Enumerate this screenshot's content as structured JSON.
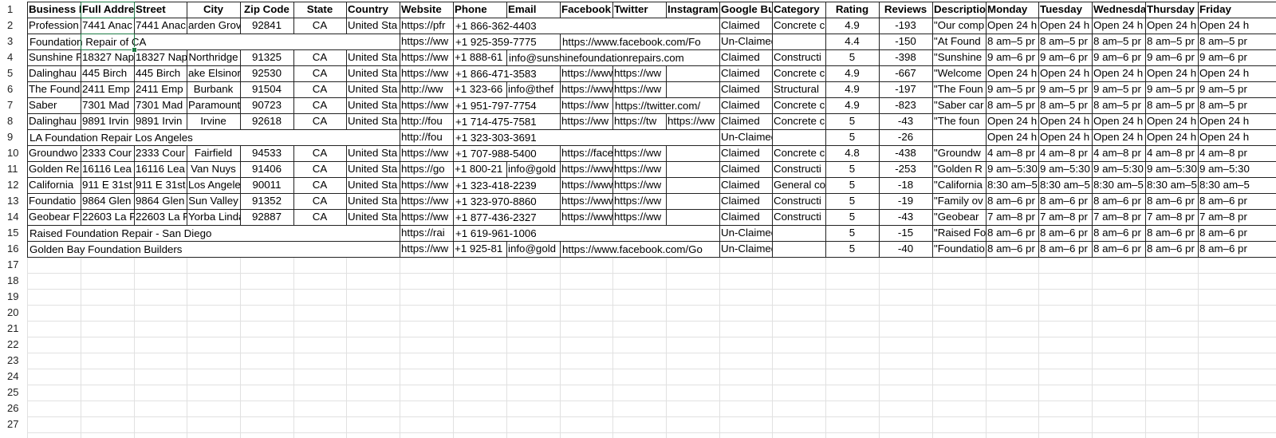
{
  "row_numbers": [
    "1",
    "2",
    "3",
    "4",
    "5",
    "6",
    "7",
    "8",
    "9",
    "10",
    "11",
    "12",
    "13",
    "14",
    "15",
    "16",
    "17",
    "18",
    "19",
    "20",
    "21",
    "22",
    "23",
    "24",
    "25",
    "26",
    "27"
  ],
  "headers": [
    "Business N",
    "Full Addre",
    "Street",
    "City",
    "Zip Code",
    "State",
    "Country",
    "Website",
    "Phone",
    "Email",
    "Facebook",
    "Twitter",
    "Instagram",
    "Google Bu",
    "Category",
    "Rating",
    "Reviews",
    "Descriptio",
    "Monday",
    "Tuesday",
    "Wednesda",
    "Thursday",
    "Friday"
  ],
  "rows": [
    [
      "Profession",
      "7441 Anac",
      "7441 Anac",
      "arden Grov",
      "92841",
      "CA",
      "United Sta",
      "https://pfr",
      "+1 866-362-4403",
      "",
      "",
      "",
      "",
      "Claimed",
      "Concrete c",
      "4.9",
      "-193",
      "\"Our comp",
      "Open 24 h",
      "Open 24 h",
      "Open 24 h",
      "Open 24 h",
      "Open 24 h"
    ],
    [
      "Foundation Repair of CA",
      "",
      "",
      "",
      "",
      "",
      "",
      "https://ww",
      "+1 925-359-7775",
      "",
      "https://www.facebook.com/Fo",
      "",
      "",
      "Un-Claimed",
      "",
      "4.4",
      "-150",
      "\"At Found",
      "8 am–5 pr",
      "8 am–5 pr",
      "8 am–5 pr",
      "8 am–5 pr",
      "8 am–5 pr"
    ],
    [
      "Sunshine F",
      "18327 Nap",
      "18327 Nap",
      "Northridge",
      "91325",
      "CA",
      "United Sta",
      "https://ww",
      "+1 888-61",
      "info@sunshinefoundationrepairs.com",
      "",
      "",
      "",
      "Claimed",
      "Constructi",
      "5",
      "-398",
      "\"Sunshine",
      "9 am–6 pr",
      "9 am–6 pr",
      "9 am–6 pr",
      "9 am–6 pr",
      "9 am–6 pr"
    ],
    [
      "Dalinghau",
      "445 Birch",
      "445 Birch",
      "ake Elsinor",
      "92530",
      "CA",
      "United Sta",
      "https://ww",
      "+1 866-471-3583",
      "",
      "https://www.facebo",
      "https://ww",
      "",
      "Claimed",
      "Concrete c",
      "4.9",
      "-667",
      "\"Welcome",
      "Open 24 h",
      "Open 24 h",
      "Open 24 h",
      "Open 24 h",
      "Open 24 h"
    ],
    [
      "The Found",
      "2411 Emp",
      "2411 Emp",
      "Burbank",
      "91504",
      "CA",
      "United Sta",
      "http://ww",
      "+1 323-66",
      "info@thef",
      "https://www.facebo",
      "https://ww",
      "",
      "Claimed",
      "Structural",
      "4.9",
      "-197",
      "\"The Foun",
      "9 am–5 pr",
      "9 am–5 pr",
      "9 am–5 pr",
      "9 am–5 pr",
      "9 am–5 pr"
    ],
    [
      "Saber",
      "7301 Mad",
      "7301 Mad",
      "Paramount",
      "90723",
      "CA",
      "United Sta",
      "https://ww",
      "+1 951-797-7754",
      "",
      "https://ww",
      "https://twitter.com/",
      "",
      "Claimed",
      "Concrete c",
      "4.9",
      "-823",
      "\"Saber car",
      "8 am–5 pr",
      "8 am–5 pr",
      "8 am–5 pr",
      "8 am–5 pr",
      "8 am–5 pr"
    ],
    [
      "Dalinghau",
      "9891 Irvin",
      "9891 Irvin",
      "Irvine",
      "92618",
      "CA",
      "United Sta",
      "http://fou",
      "+1 714-475-7581",
      "",
      "https://ww",
      "https://tw",
      "https://ww",
      "Claimed",
      "Concrete c",
      "5",
      "-43",
      "\"The foun",
      "Open 24 h",
      "Open 24 h",
      "Open 24 h",
      "Open 24 h",
      "Open 24 h"
    ],
    [
      "LA Foundation Repair Los Angeles",
      "",
      "",
      "",
      "",
      "",
      "",
      "http://fou",
      "+1 323-303-3691",
      "",
      "",
      "",
      "",
      "Un-Claimed",
      "",
      "5",
      "-26",
      "",
      "Open 24 h",
      "Open 24 h",
      "Open 24 h",
      "Open 24 h",
      "Open 24 h"
    ],
    [
      "Groundwo",
      "2333 Cour",
      "2333 Cour",
      "Fairfield",
      "94533",
      "CA",
      "United Sta",
      "https://ww",
      "+1 707-988-5400",
      "",
      "https://facebook.co",
      "https://ww",
      "",
      "Claimed",
      "Concrete c",
      "4.8",
      "-438",
      "\"Groundw",
      "4 am–8 pr",
      "4 am–8 pr",
      "4 am–8 pr",
      "4 am–8 pr",
      "4 am–8 pr"
    ],
    [
      "Golden Re",
      "16116 Lea",
      "16116 Lea",
      "Van Nuys",
      "91406",
      "CA",
      "United Sta",
      "https://go",
      "+1 800-21",
      "info@gold",
      "https://www.facebo",
      "https://ww",
      "",
      "Claimed",
      "Constructi",
      "5",
      "-253",
      "\"Golden R",
      "9 am–5:30",
      "9 am–5:30",
      "9 am–5:30",
      "9 am–5:30",
      "9 am–5:30"
    ],
    [
      "California",
      "911 E 31st",
      "911 E 31st",
      "Los Angele",
      "90011",
      "CA",
      "United Sta",
      "https://ww",
      "+1 323-418-2239",
      "",
      "https://www.facebo",
      "https://ww",
      "",
      "Claimed",
      "General co",
      "5",
      "-18",
      "\"California",
      "8:30 am–5",
      "8:30 am–5",
      "8:30 am–5",
      "8:30 am–5",
      "8:30 am–5"
    ],
    [
      "Foundatio",
      "9864 Glen",
      "9864 Glen",
      "Sun Valley",
      "91352",
      "CA",
      "United Sta",
      "https://ww",
      "+1 323-970-8860",
      "",
      "https://www.facebo",
      "https://ww",
      "",
      "Claimed",
      "Constructi",
      "5",
      "-19",
      "\"Family ov",
      "8 am–6 pr",
      "8 am–6 pr",
      "8 am–6 pr",
      "8 am–6 pr",
      "8 am–6 pr"
    ],
    [
      "Geobear F",
      "22603 La P",
      "22603 La P",
      "Yorba Linda",
      "92887",
      "CA",
      "United Sta",
      "https://ww",
      "+1 877-436-2327",
      "",
      "https://www.facebo",
      "https://ww",
      "",
      "Claimed",
      "Constructi",
      "5",
      "-43",
      "\"Geobear",
      "7 am–8 pr",
      "7 am–8 pr",
      "7 am–8 pr",
      "7 am–8 pr",
      "7 am–8 pr"
    ],
    [
      "Raised Foundation Repair - San Diego",
      "",
      "",
      "",
      "",
      "",
      "",
      "https://rai",
      "+1 619-961-1006",
      "",
      "",
      "",
      "",
      "Un-Claimed",
      "",
      "5",
      "-15",
      "\"Raised Fo",
      "8 am–6 pr",
      "8 am–6 pr",
      "8 am–6 pr",
      "8 am–6 pr",
      "8 am–6 pr"
    ],
    [
      "Golden Bay Foundation Builders",
      "",
      "",
      "",
      "",
      "",
      "",
      "https://ww",
      "+1 925-81",
      "info@gold",
      "https://www.facebook.com/Go",
      "",
      "",
      "Un-Claimed",
      "",
      "5",
      "-40",
      "\"Foundatio",
      "8 am–6 pr",
      "8 am–6 pr",
      "8 am–6 pr",
      "8 am–6 pr",
      "8 am–6 pr"
    ]
  ],
  "colors": {
    "grid_dark": "#222222",
    "grid_light": "#e1e1e1",
    "selection": "#1f7a45"
  }
}
